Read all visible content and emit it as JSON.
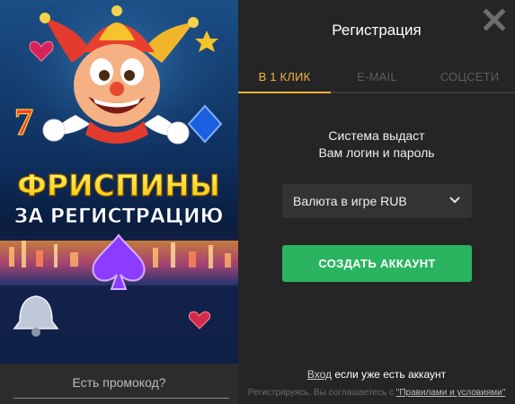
{
  "promo": {
    "title_line1": "ФРИСПИНЫ",
    "title_line2": "ЗА РЕГИСТРАЦИЮ",
    "promo_code_link": "Есть промокод?"
  },
  "dialog": {
    "title": "Регистрация",
    "tabs": [
      {
        "label": "В 1 КЛИК",
        "active": true
      },
      {
        "label": "E-MAIL",
        "active": false
      },
      {
        "label": "СОЦСЕТИ",
        "active": false
      }
    ],
    "info_line1": "Система выдаст",
    "info_line2": "Вам логин и пароль",
    "currency_select": "Валюта в игре RUB",
    "create_button": "СОЗДАТЬ АККАУНТ",
    "login_link": "Вход",
    "login_suffix": " если уже есть аккаунт",
    "terms_prefix": "Регистрируясь, Вы соглашаетесь с ",
    "terms_link": "\"Правилами и условиями\""
  },
  "colors": {
    "accent": "#f2b23a",
    "button": "#2bb45f",
    "panel": "#252525"
  },
  "icons": [
    "close-icon",
    "chevron-down-icon",
    "jester-icon",
    "heart-icon",
    "star-icon",
    "seven-icon",
    "diamond-icon",
    "spade-icon",
    "bell-icon"
  ]
}
